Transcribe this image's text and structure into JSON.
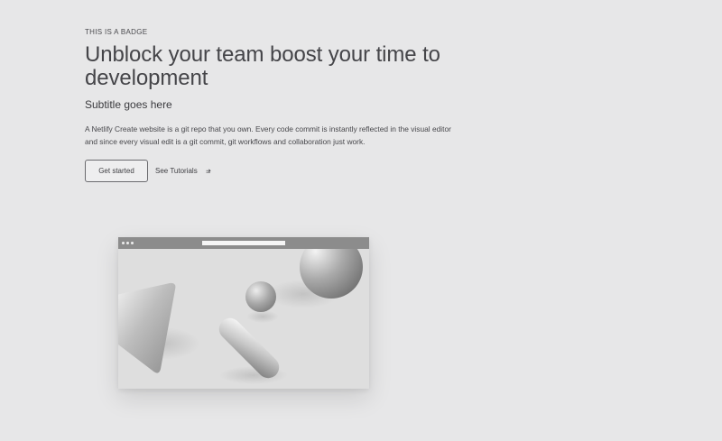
{
  "hero": {
    "badge": "THIS IS A BADGE",
    "title": "Unblock your team boost your time to development",
    "subtitle": "Subtitle goes here",
    "body": "A Netlify Create website is a git repo that you own. Every code commit is instantly reflected in the visual editor and since every visual edit is a git commit, git workflows and collaboration just work.",
    "primary_button": "Get started",
    "secondary_link": "See Tutorials",
    "secondary_link_icon": "arrow-right-icon"
  },
  "illustration": {
    "type": "browser-window-mockup",
    "shapes": [
      "triangle",
      "sphere-small",
      "capsule",
      "sphere-large"
    ]
  },
  "colors": {
    "background": "#e7e7e8",
    "text": "#3e3e42",
    "browser_bar": "#8c8c8c"
  }
}
